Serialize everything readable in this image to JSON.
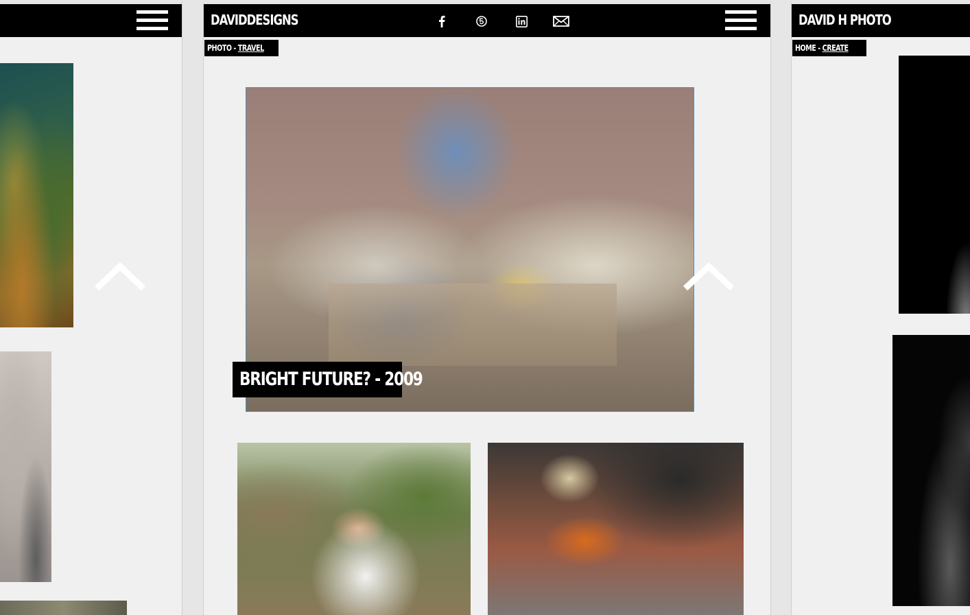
{
  "left_panel": {
    "menu_label": "menu"
  },
  "center_panel": {
    "brand": "DAVIDDESIGNS",
    "breadcrumb": {
      "prefix": "PHOTO - ",
      "link": "TRAVEL"
    },
    "social_icons": [
      "facebook-icon",
      "500px-icon",
      "linkedin-icon",
      "email-icon"
    ],
    "featured": {
      "caption": "BRIGHT FUTURE? - 2009"
    }
  },
  "right_panel": {
    "brand": "DAVID H PHOTO",
    "breadcrumb": {
      "prefix": "HOME - ",
      "link": "CREATE"
    }
  },
  "colors": {
    "bar": "#000000",
    "panel_bg": "#f0f0f0",
    "highlight_border": "#3d8fd6"
  }
}
